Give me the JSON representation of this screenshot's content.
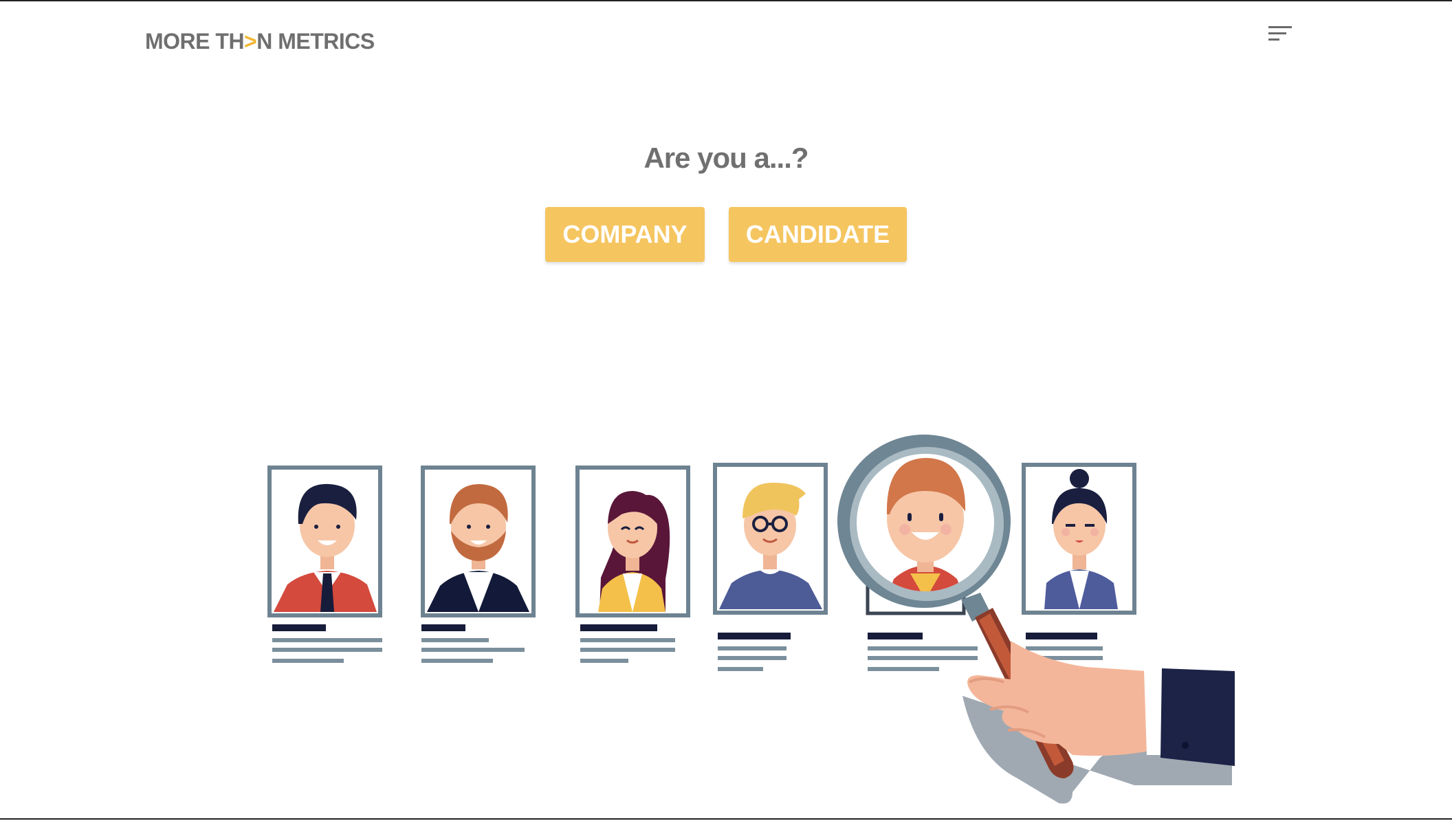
{
  "header": {
    "logo_part1": "MORE TH",
    "logo_accent": ">",
    "logo_part2": "N METRICS",
    "menu_icon": "hamburger-menu-icon"
  },
  "main": {
    "question": "Are you a...?",
    "company_button": "COMPANY",
    "candidate_button": "CANDIDATE"
  },
  "illustration": {
    "subject": "hand holding magnifying glass over six candidate profile cards",
    "icon": "candidate-search-illustration"
  },
  "colors": {
    "accent": "#f3b631",
    "button": "#f5c560",
    "text_gray": "#707070",
    "frame_gray": "#6e8391",
    "navy": "#1c2347"
  }
}
